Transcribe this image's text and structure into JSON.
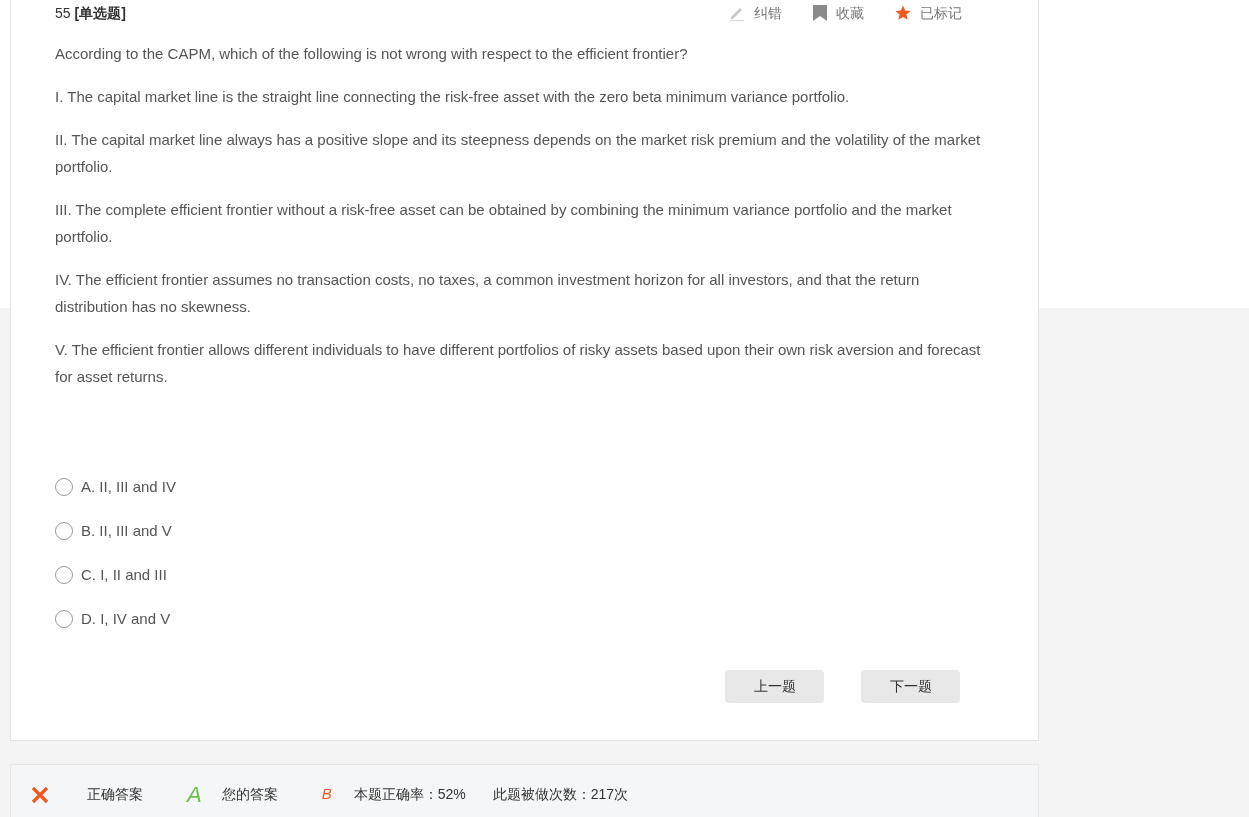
{
  "question": {
    "number": "55",
    "type": "[单选题]",
    "tools": [
      {
        "kind": "report",
        "label": "纠错"
      },
      {
        "kind": "favorite",
        "label": "收藏"
      },
      {
        "kind": "mark",
        "label": "已标记",
        "on": true
      }
    ],
    "paragraphs": [
      "According to the CAPM, which of the following is not wrong with respect to the efficient frontier?",
      "I. The capital market line is the straight line connecting the risk-free asset with the zero beta minimum variance portfolio.",
      "II. The capital market line always has a positive slope and its steepness depends on the market risk premium and the volatility of the market portfolio.",
      "III. The complete efficient frontier without a risk-free asset can be obtained by combining the minimum variance portfolio and the market portfolio.",
      "IV. The efficient frontier assumes no transaction costs, no taxes, a common investment horizon for all investors, and that the return distribution has no skewness.",
      "V. The efficient frontier allows different individuals to have different portfolios of risky assets based upon their own risk aversion and forecast for asset returns."
    ],
    "options": [
      {
        "label": "A. II, III and IV",
        "selected": false
      },
      {
        "label": "B. II, III and V",
        "selected": false
      },
      {
        "label": "C. I, II and III",
        "selected": false
      },
      {
        "label": "D. I, IV and V",
        "selected": false
      }
    ],
    "buttons": [
      "上一题",
      "下一题"
    ]
  },
  "result": {
    "correct": false,
    "correct_label": "正确答案",
    "correct_answer": "A",
    "your_label": "您的答案",
    "your_answer": "B",
    "rate": "本题正确率：52%",
    "count": "此题被做次数：217次"
  }
}
